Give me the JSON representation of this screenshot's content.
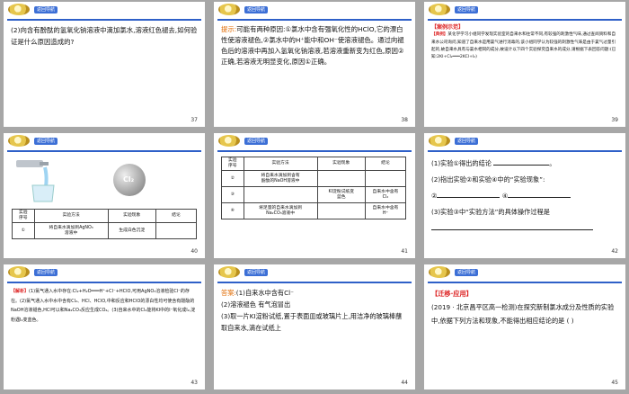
{
  "header": {
    "back_label": "返回导航"
  },
  "slides": [
    {
      "number": "37",
      "text": "(2)向含有酚酞的氢氧化钠溶液中滴加氯水,溶液红色褪去,如何验证是什么原因造成的?"
    },
    {
      "number": "38",
      "hint_label": "提示:",
      "text": "可能有两种原因:①氯水中含有强氧化性的HClO,它的漂白性使溶液褪色,②氯水中的H⁺能中和OH⁻使溶液褪色。通过向褪色后的溶液中再加入氢氧化钠溶液,若溶液重新变为红色,原因②正确,若溶液无明显变化,原因①正确。"
    },
    {
      "number": "39",
      "case_label": "【案例示范】",
      "typical_label": "【典例】",
      "text": "某化学学习小组同学发现实验室的自来水和往常不同,有较强的刺激性气味,通过查阅资料和自来水公司询问,知道了自来水是用氯气进行消毒的,该小组同学认为较强的刺激性气味是由于氯气过量引起的,故自来水具有与氯水相同的成分,故设计以下四个实验探究自来水的成分,请根据下表回答问题:(已知:2KI+Cl₂═══2KCl+I₂)"
    },
    {
      "number": "40",
      "img_label": "Cl₂",
      "table": {
        "headers": [
          "实验\n序号",
          "实验方法",
          "实验现象",
          "结论"
        ],
        "rows": [
          [
            "①",
            "将自来水滴加到AgNO₃\n溶液中",
            "生成白色沉淀",
            ""
          ]
        ]
      }
    },
    {
      "number": "41",
      "table": {
        "headers": [
          "实验\n序号",
          "实验方法",
          "实验现象",
          "结论"
        ],
        "rows": [
          [
            "②",
            "将自来水滴加到含有\n酚酞的NaOH溶液中",
            "",
            ""
          ],
          [
            "③",
            "",
            "KI淀粉试纸变\n蓝色",
            "自来水中含有\nCl₂"
          ],
          [
            "④",
            "将足量的自来水滴加到\nNa₂CO₃溶液中",
            "",
            "自来水中含有\nH⁺"
          ]
        ]
      }
    },
    {
      "number": "42",
      "lines": [
        "(1)实验①得出的结论",
        "(2)指出实验②和实验④中的“实验现象”:",
        "②",
        "④",
        "(3)实验③中“实验方法”的具体操作过程是"
      ]
    },
    {
      "number": "43",
      "analysis_label": "【解析】",
      "text": "(1)氯气通入水中存在:Cl₂+H₂O═══H⁺+Cl⁻+HClO,可用AgNO₃溶液检验Cl⁻的存在。(2)氯气通入水中水中含有Cl₂、HCl、HClO,中和反应和HClO的漂白性均可使含有酚酞的NaOH溶液褪色,HCl可以和Na₂CO₃反应生成CO₂。(3)自来水中的Cl₂能将KI中的I⁻氧化成I₂,淀粉遇I₂变蓝色。"
    },
    {
      "number": "44",
      "answer_label": "答案:",
      "lines": [
        "(1)自来水中含有Cl⁻",
        "(2)溶液褪色  有气泡冒出",
        "(3)取一片KI淀粉试纸,置于表面皿或玻璃片上,用洁净的玻璃棒蘸取自来水,滴在试纸上"
      ]
    },
    {
      "number": "45",
      "transfer_label": "【迁移·应用】",
      "text": "(2019 · 北京昌平区高一检测)在探究新制氯水成分及性质的实验中,依据下列方法和现象,不能得出相应结论的是   (    )"
    }
  ]
}
